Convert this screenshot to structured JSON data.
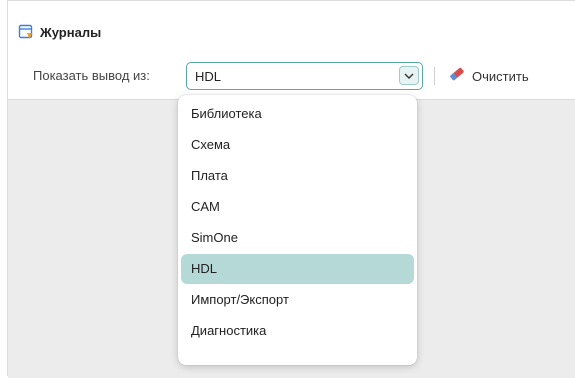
{
  "panel": {
    "title": "Журналы",
    "icon": "log-panel-icon"
  },
  "toolbar": {
    "show_output_label": "Показать вывод из:",
    "selected_source": "HDL",
    "clear_label": "Очистить",
    "clear_icon": "eraser-icon"
  },
  "dropdown": {
    "options": [
      {
        "label": "Библиотека",
        "selected": false
      },
      {
        "label": "Схема",
        "selected": false
      },
      {
        "label": "Плата",
        "selected": false
      },
      {
        "label": "CAM",
        "selected": false
      },
      {
        "label": "SimOne",
        "selected": false
      },
      {
        "label": "HDL",
        "selected": true
      },
      {
        "label": "Импорт/Экспорт",
        "selected": false
      },
      {
        "label": "Диагностика",
        "selected": false
      }
    ]
  },
  "colors": {
    "accent": "#5aa6a4",
    "selected_bg": "#b5d9d7",
    "output_bg": "#ececec"
  }
}
